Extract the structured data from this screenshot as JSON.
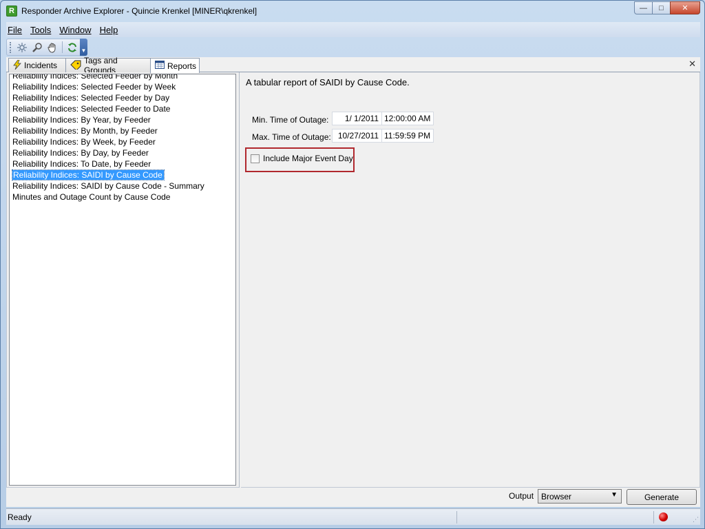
{
  "window": {
    "title": "Responder Archive Explorer - Quincie Krenkel [MINER\\qkrenkel]",
    "app_icon_text": "R"
  },
  "menu": [
    {
      "label": "File"
    },
    {
      "label": "Tools"
    },
    {
      "label": "Window"
    },
    {
      "label": "Help"
    }
  ],
  "toolbar": {
    "icons": [
      "select-icon",
      "zoom-icon",
      "pan-hand-icon",
      "refresh-icon"
    ]
  },
  "tabs": [
    {
      "label": "Incidents",
      "icon": "lightning-icon"
    },
    {
      "label": "Tags and Grounds",
      "icon": "tag-icon"
    },
    {
      "label": "Reports",
      "icon": "calendar-icon"
    }
  ],
  "reports_list": [
    "Reliability Indices: Selected Feeder by Month",
    "Reliability Indices: Selected Feeder by Week",
    "Reliability Indices: Selected Feeder by Day",
    "Reliability Indices: Selected Feeder to Date",
    "Reliability Indices: By Year, by Feeder",
    "Reliability Indices: By Month, by Feeder",
    "Reliability Indices: By Week, by Feeder",
    "Reliability Indices: By Day, by Feeder",
    "Reliability Indices: To Date, by Feeder",
    "Reliability Indices: SAIDI by Cause Code",
    "Reliability Indices: SAIDI by Cause Code - Summary",
    "Minutes and Outage Count by Cause Code"
  ],
  "selected_report_index": 9,
  "report": {
    "description": "A tabular report of SAIDI by Cause Code.",
    "min_label": "Min. Time of Outage:",
    "min_date": "1/  1/2011",
    "min_time": "12:00:00 AM",
    "max_label": "Max. Time of Outage:",
    "max_date": "10/27/2011",
    "max_time": "11:59:59 PM",
    "major_event_label": "Include Major Event Day",
    "major_event_checked": false
  },
  "output": {
    "label": "Output",
    "selected": "Browser",
    "generate_label": "Generate"
  },
  "status": {
    "text": "Ready",
    "indicator_color": "#d00000"
  }
}
